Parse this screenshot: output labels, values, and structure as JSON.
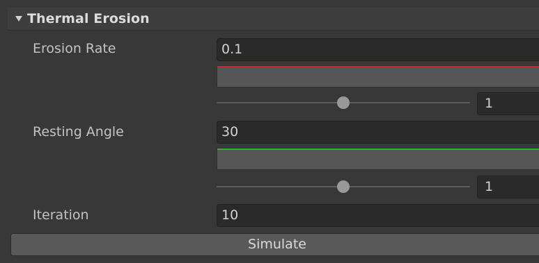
{
  "section": {
    "title": "Thermal Erosion",
    "expanded": true
  },
  "erosion_rate": {
    "label": "Erosion Rate",
    "value": "0.1",
    "curve_color": "#c8282a",
    "slider_value": "1",
    "slider_position": 0.5
  },
  "resting_angle": {
    "label": "Resting Angle",
    "value": "30",
    "curve_color": "#2fb82f",
    "slider_value": "1",
    "slider_position": 0.5
  },
  "iteration": {
    "label": "Iteration",
    "value": "10"
  },
  "simulate_button": {
    "label": "Simulate"
  }
}
